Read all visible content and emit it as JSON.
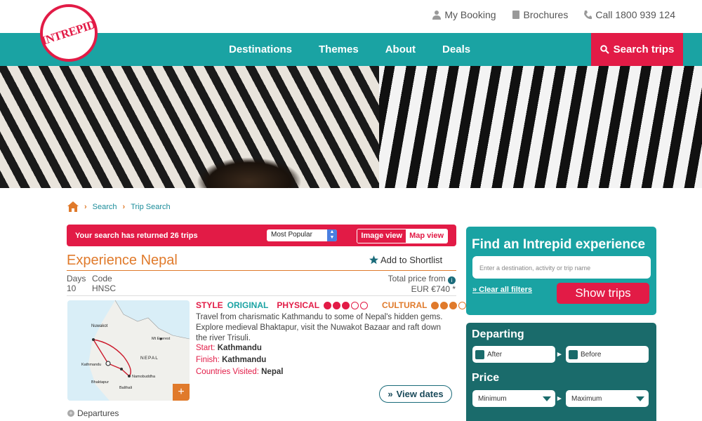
{
  "header": {
    "logo_text": "INTREPID",
    "utility_links": [
      "My Booking",
      "Brochures",
      "Call 1800 939 124"
    ],
    "nav": [
      "Destinations",
      "Themes",
      "About",
      "Deals"
    ],
    "search_trips": "Search trips"
  },
  "breadcrumb": [
    "Search",
    "Trip Search"
  ],
  "results": {
    "summary": "Your search has returned 26 trips",
    "sort_selected": "Most Popular",
    "image_view": "Image view",
    "map_view": "Map view"
  },
  "trip": {
    "title": "Experience Nepal",
    "shortlist": "Add to Shortlist",
    "days_label": "Days",
    "days": "10",
    "code_label": "Code",
    "code": "HNSC",
    "price_label": "Total price from",
    "price": "EUR €740 *",
    "style_label": "STYLE",
    "style_value": "ORIGINAL",
    "physical_label": "PHYSICAL",
    "physical_rating": 3,
    "cultural_label": "CULTURAL",
    "cultural_rating": 3,
    "description": "Travel from charismatic Kathmandu to some of Nepal's hidden gems. Explore medieval Bhaktapur, visit the Nuwakot Bazaar and raft down the river Trisuli.",
    "start_label": "Start:",
    "start": "Kathmandu",
    "finish_label": "Finish:",
    "finish": "Kathmandu",
    "countries_label": "Countries Visited:",
    "countries": "Nepal",
    "view_dates": "View dates",
    "departures": "Departures",
    "map_labels": [
      "Nuwakot",
      "Mt Everest",
      "NEPAL",
      "Kathmandu",
      "Bhaktapur",
      "Namobuddha",
      "Balthali"
    ]
  },
  "finder": {
    "title": "Find an Intrepid experience",
    "placeholder": "Enter a destination, activity or trip name",
    "clear": "» Clear all filters",
    "show_trips": "Show trips"
  },
  "filters": {
    "departing_title": "Departing",
    "after": "After",
    "before": "Before",
    "price_title": "Price",
    "minimum": "Minimum",
    "maximum": "Maximum"
  },
  "colors": {
    "teal": "#1aa3a3",
    "red": "#e21b46",
    "orange": "#e07a2b",
    "dark_teal": "#1a6b6b"
  }
}
